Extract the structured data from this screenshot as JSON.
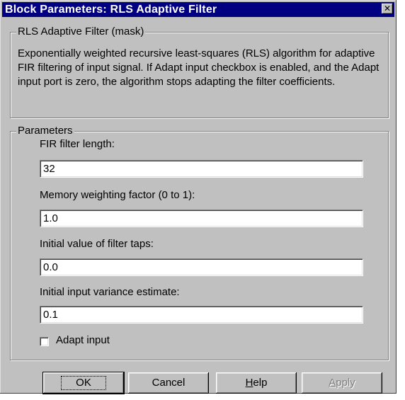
{
  "window": {
    "title": "Block Parameters: RLS Adaptive Filter"
  },
  "mask_group": {
    "legend": "RLS Adaptive Filter (mask)",
    "description": "Exponentially weighted recursive least-squares (RLS) algorithm for adaptive FIR filtering of input signal. If Adapt input checkbox is enabled, and the Adapt input port is zero, the algorithm stops adapting the filter coefficients."
  },
  "params_group": {
    "legend": "Parameters",
    "fields": [
      {
        "label": "FIR filter length:",
        "value": "32"
      },
      {
        "label": "Memory weighting factor (0 to 1):",
        "value": "1.0"
      },
      {
        "label": "Initial value of filter taps:",
        "value": "0.0"
      },
      {
        "label": "Initial input variance estimate:",
        "value": "0.1"
      }
    ],
    "checkbox": {
      "label": "Adapt input",
      "checked": false
    }
  },
  "buttons": {
    "ok": "OK",
    "cancel": "Cancel",
    "help_underlined": "H",
    "help_rest": "elp",
    "apply_underlined": "A",
    "apply_rest": "pply"
  },
  "colors": {
    "titlebar": "#000080",
    "face": "#c0c0c0",
    "disabled_text": "#808080"
  }
}
